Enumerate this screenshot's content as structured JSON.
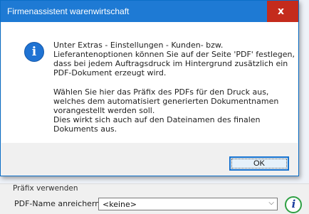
{
  "dialog": {
    "title": "Firmenassistent warenwirtschaft",
    "close_glyph": "x",
    "message_icon": "info-icon",
    "message_icon_glyph": "i",
    "lines": [
      "Unter Extras - Einstellungen - Kunden- bzw.",
      "Lieferantenoptionen können Sie auf der Seite 'PDF' festlegen,",
      "dass bei jedem Auftragsdruck im Hintergrund zusätzlich ein",
      "PDF-Dokument erzeugt wird.",
      "Wählen Sie hier das Präfix des PDFs für den Druck aus,",
      "welches dem automatisiert generierten Dokumentnamen",
      "vorangestellt werden soll.",
      "Dies wirkt sich auch auf den Dateinamen des finalen",
      "Dokuments aus."
    ],
    "ok_label": "OK"
  },
  "background": {
    "group_label": "Präfix verwenden",
    "pdf_name_label": "PDF-Name anreichern",
    "pdf_name_value": "<keine>",
    "info_button_glyph": "i"
  },
  "colors": {
    "titlebar": "#1e7ad4",
    "close": "#c42b1c",
    "info_highlight": "#2ea043"
  }
}
